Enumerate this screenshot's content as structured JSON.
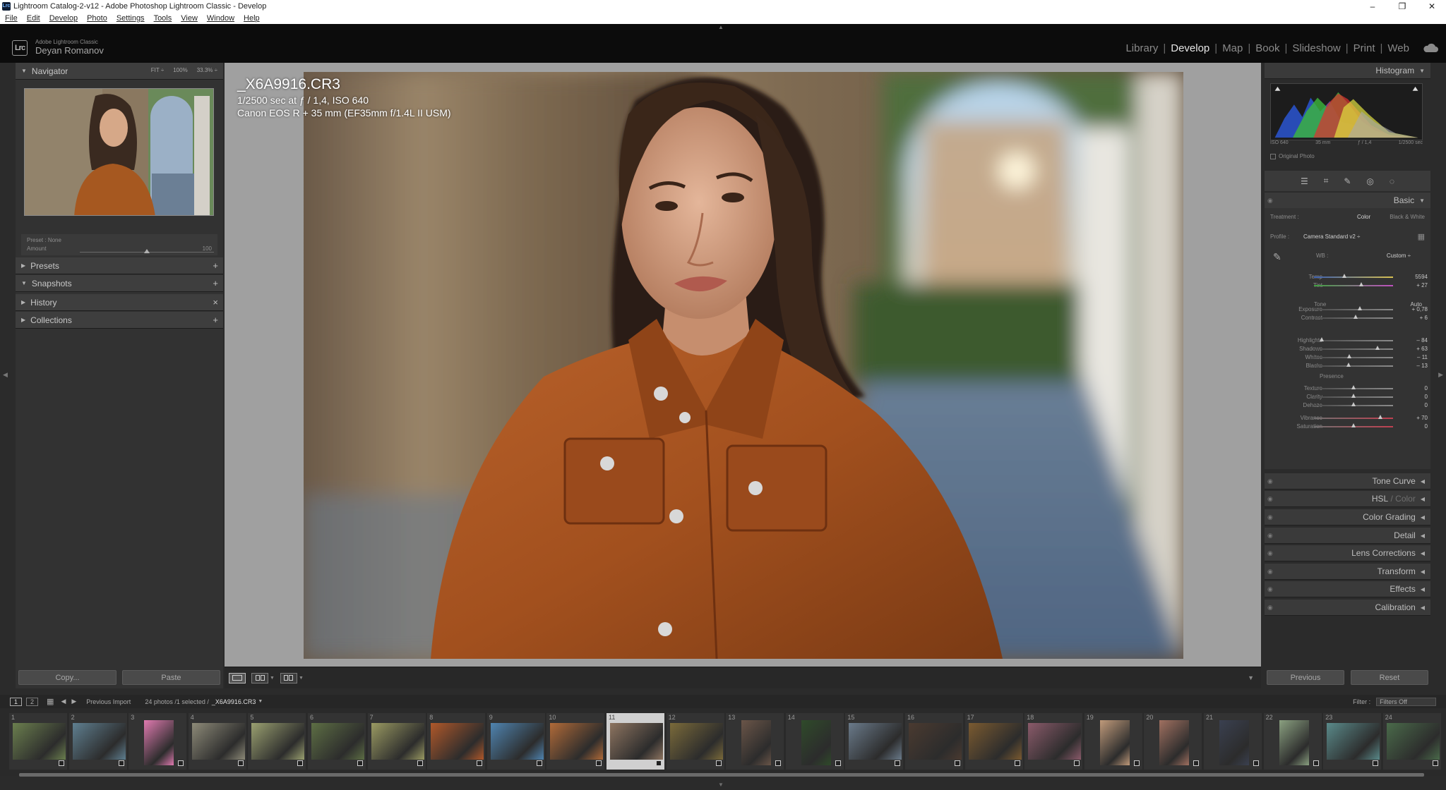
{
  "window": {
    "title": "Lightroom Catalog-2-v12 - Adobe Photoshop Lightroom Classic - Develop",
    "app_icon": "Lrc",
    "controls": [
      "–",
      "❐",
      "✕"
    ]
  },
  "menu": [
    "File",
    "Edit",
    "Develop",
    "Photo",
    "Settings",
    "Tools",
    "View",
    "Window",
    "Help"
  ],
  "identity": {
    "small": "Adobe Lightroom Classic",
    "name": "Deyan Romanov",
    "badge": "Lrc"
  },
  "modules": [
    {
      "label": "Library",
      "active": false
    },
    {
      "label": "Develop",
      "active": true
    },
    {
      "label": "Map",
      "active": false
    },
    {
      "label": "Book",
      "active": false
    },
    {
      "label": "Slideshow",
      "active": false
    },
    {
      "label": "Print",
      "active": false
    },
    {
      "label": "Web",
      "active": false
    }
  ],
  "module_separator": "|",
  "navigator": {
    "title": "Navigator",
    "zoom": [
      "FIT ÷",
      "100%",
      "33.3% ÷"
    ]
  },
  "preset_box": {
    "preset_label": "Preset :",
    "preset_value": "None",
    "amount_label": "Amount",
    "amount_value": "100",
    "amount_level": 0.5
  },
  "left_sections": [
    {
      "label": "Presets",
      "action": "+"
    },
    {
      "label": "Snapshots",
      "action": "+"
    },
    {
      "label": "History",
      "action": "×"
    },
    {
      "label": "Collections",
      "action": "+"
    }
  ],
  "left_buttons": {
    "copy": "Copy...",
    "paste": "Paste"
  },
  "photo_info": {
    "filename": "_X6A9916.CR3",
    "exposure": "1/2500 sec at ƒ / 1,4, ISO 640",
    "camera": "Canon EOS R + 35 mm (EF35mm f/1.4L II USM)"
  },
  "histogram": {
    "title": "Histogram",
    "labels": [
      "ISO 640",
      "35 mm",
      "ƒ / 1,4",
      "1/2500 sec"
    ],
    "original_photo": "Original Photo"
  },
  "basic": {
    "title": "Basic",
    "treatment_label": "Treatment :",
    "treatment_color": "Color",
    "treatment_bw": "Black & White",
    "profile_label": "Profile :",
    "profile_value": "Camera Standard v2 ÷",
    "wb_label": "WB :",
    "wb_value": "Custom ÷",
    "tone_label": "Tone",
    "auto_label": "Auto",
    "presence_label": "Presence",
    "sliders": [
      {
        "label": "Temp",
        "value": "5594",
        "pos": 0.38
      },
      {
        "label": "Tint",
        "value": "+ 27",
        "pos": 0.6
      },
      {
        "label": "Exposure",
        "value": "+ 0,78",
        "pos": 0.58
      },
      {
        "label": "Contrast",
        "value": "+ 6",
        "pos": 0.53
      },
      {
        "label": "Highlights",
        "value": "– 84",
        "pos": 0.1
      },
      {
        "label": "Shadows",
        "value": "+ 63",
        "pos": 0.8
      },
      {
        "label": "Whites",
        "value": "– 11",
        "pos": 0.45
      },
      {
        "label": "Blacks",
        "value": "– 13",
        "pos": 0.44
      },
      {
        "label": "Texture",
        "value": "0",
        "pos": 0.5
      },
      {
        "label": "Clarity",
        "value": "0",
        "pos": 0.5
      },
      {
        "label": "Dehaze",
        "value": "0",
        "pos": 0.5
      },
      {
        "label": "Vibrance",
        "value": "+ 70",
        "pos": 0.84
      },
      {
        "label": "Saturation",
        "value": "0",
        "pos": 0.5
      }
    ]
  },
  "right_sections": [
    {
      "label": "Tone Curve"
    },
    {
      "label": "HSL",
      "dim": "/ Color"
    },
    {
      "label": "Color Grading"
    },
    {
      "label": "Detail"
    },
    {
      "label": "Lens Corrections"
    },
    {
      "label": "Transform"
    },
    {
      "label": "Effects"
    },
    {
      "label": "Calibration"
    }
  ],
  "right_buttons": {
    "previous": "Previous",
    "reset": "Reset"
  },
  "filmstrip_bar": {
    "screen1": "1",
    "screen2": "2",
    "source": "Previous Import",
    "count": "24 photos /1 selected /",
    "selected_file": "_X6A9916.CR3",
    "filter_label": "Filter :",
    "filter_value": "Filters Off"
  },
  "filmstrip": [
    {
      "n": "1",
      "c": "#6b7f4e",
      "p": false
    },
    {
      "n": "2",
      "c": "#5f7f90",
      "p": false
    },
    {
      "n": "3",
      "c": "#e07ab0",
      "p": true
    },
    {
      "n": "4",
      "c": "#8d8a78",
      "p": false
    },
    {
      "n": "5",
      "c": "#9aa070",
      "p": false
    },
    {
      "n": "6",
      "c": "#5d6e44",
      "p": false
    },
    {
      "n": "7",
      "c": "#9a9a62",
      "p": false
    },
    {
      "n": "8",
      "c": "#b0582a",
      "p": false
    },
    {
      "n": "9",
      "c": "#4f84b0",
      "p": false
    },
    {
      "n": "10",
      "c": "#b06a38",
      "p": false
    },
    {
      "n": "11",
      "c": "#8d7460",
      "p": false,
      "sel": true
    },
    {
      "n": "12",
      "c": "#7a6a3a",
      "p": false
    },
    {
      "n": "13",
      "c": "#6a5548",
      "p": true
    },
    {
      "n": "14",
      "c": "#2f4a2a",
      "p": true
    },
    {
      "n": "15",
      "c": "#6a7a8a",
      "p": false
    },
    {
      "n": "16",
      "c": "#4a3a30",
      "p": false
    },
    {
      "n": "17",
      "c": "#7a5a30",
      "p": false
    },
    {
      "n": "18",
      "c": "#8a5a6a",
      "p": false
    },
    {
      "n": "19",
      "c": "#c09a7a",
      "p": true
    },
    {
      "n": "20",
      "c": "#a07060",
      "p": true
    },
    {
      "n": "21",
      "c": "#3a4050",
      "p": true
    },
    {
      "n": "22",
      "c": "#8aa080",
      "p": true
    },
    {
      "n": "23",
      "c": "#5a8a8a",
      "p": false
    },
    {
      "n": "24",
      "c": "#4a6a4a",
      "p": false
    }
  ],
  "colors": {
    "accent": "#e6e6e6",
    "panel": "#323232",
    "photo_bg": "#a0a0a0"
  }
}
